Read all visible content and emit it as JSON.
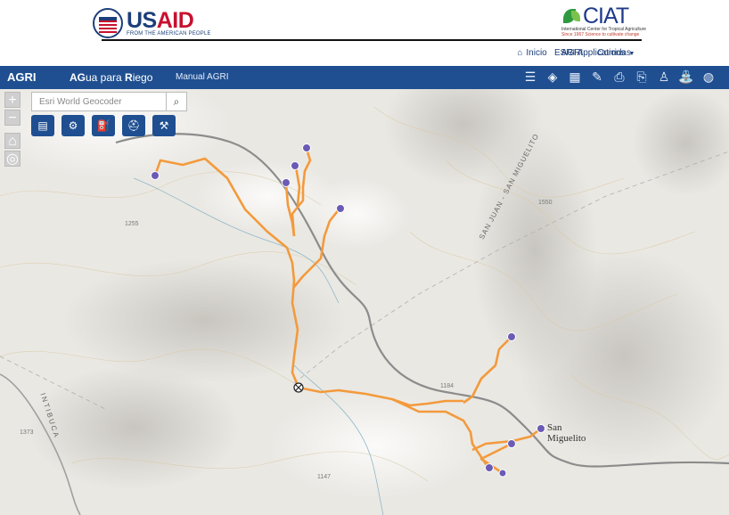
{
  "header": {
    "usaid": {
      "us": "US",
      "aid": "AID",
      "tagline": "FROM THE AMERICAN PEOPLE"
    },
    "ciat": {
      "name": "CIAT",
      "line1": "International Center for Tropical Agriculture",
      "line2": "Since 1967 Science to cultivate change"
    },
    "links": {
      "home": "Inicio",
      "agri": "AGRI",
      "runs": "Corridas",
      "esri": "ESRI Applications"
    }
  },
  "navbar": {
    "title": "AGRI",
    "subtitle_a1": "AG",
    "subtitle_a2": "ua para ",
    "subtitle_b1": "R",
    "subtitle_b2": "iego",
    "manual": "Manual AGRI",
    "icons": [
      "list-icon",
      "layers-icon",
      "basemap-gallery-icon",
      "measure-icon",
      "print-icon",
      "print-alt-icon",
      "farmer-icon",
      "irrigation-icon",
      "globe-icon"
    ]
  },
  "map": {
    "geocoder_placeholder": "Esri World Geocoder",
    "tools": [
      "document-icon",
      "tractor-icon",
      "pump-icon",
      "helmet-icon",
      "shovel-icon"
    ],
    "town_name_line1": "San",
    "town_name_line2": "Miguelito",
    "road_label": "SAN JUAN - SAN MIGUELITO",
    "dept_label": "INTIBUCA",
    "elevations": [
      "1255",
      "1550",
      "1184",
      "1373",
      "1147"
    ],
    "colors": {
      "pipe": "#f39a3c",
      "node": "#6b5bb5",
      "road": "#8f8f8f",
      "navbar": "#1f4f91"
    }
  }
}
